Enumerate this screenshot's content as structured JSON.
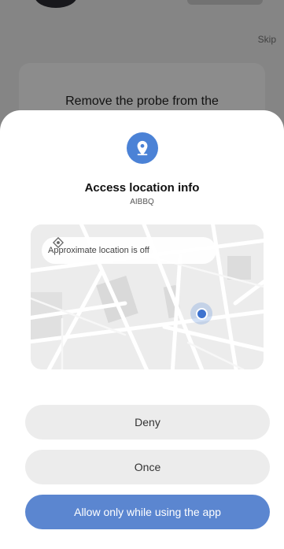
{
  "background": {
    "skip_label": "Skip",
    "card_text": "Remove the probe from the"
  },
  "dialog": {
    "icon": "location-pin-icon",
    "title": "Access location info",
    "app_name": "AIBBQ",
    "map": {
      "approximate_label": "Approximate location is off",
      "approximate_icon": "crosshair-icon"
    },
    "buttons": {
      "deny": "Deny",
      "once": "Once",
      "allow": "Allow only while using the app"
    }
  },
  "colors": {
    "accent": "#4b82d6",
    "primary_button": "#5b86d0",
    "secondary_button": "#ececec"
  }
}
